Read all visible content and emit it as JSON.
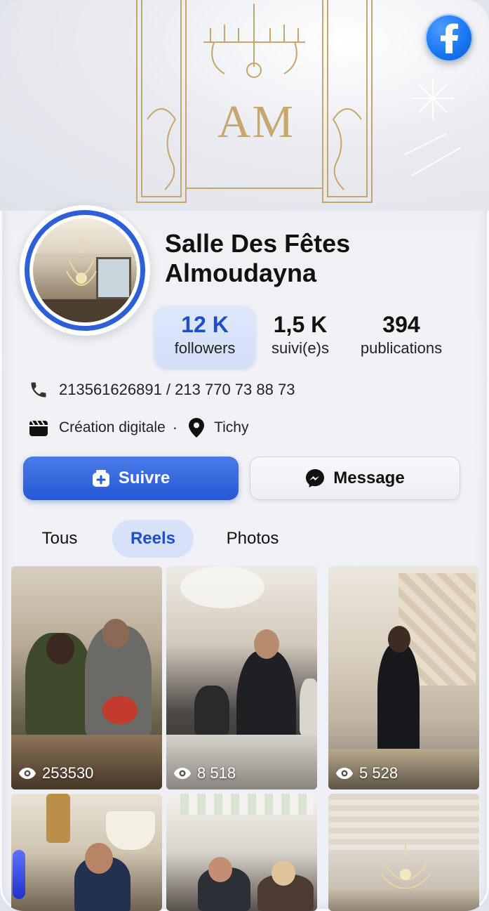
{
  "cover": {
    "monogram": "AM"
  },
  "profile": {
    "name_line1": "Salle Des Fêtes",
    "name_line2": "Almoudayna"
  },
  "stats": {
    "followers": {
      "value": "12 K",
      "label": "followers"
    },
    "following": {
      "value": "1,5 K",
      "label": "suivi(e)s"
    },
    "posts": {
      "value": "394",
      "label": "publications"
    }
  },
  "info": {
    "phone": "213561626891 / 213 770 73 88 73",
    "category": "Création digitale",
    "separator": "·",
    "location": "Tichy"
  },
  "actions": {
    "follow_label": "Suivre",
    "message_label": "Message"
  },
  "tabs": {
    "all": "Tous",
    "reels": "Reels",
    "photos": "Photos",
    "selected": "Reels"
  },
  "reels": [
    {
      "views": "253530"
    },
    {
      "views": "8 518"
    },
    {
      "views": "5 528"
    }
  ],
  "icons": {
    "badge": "facebook-icon",
    "phone": "phone-icon",
    "category": "clapperboard-icon",
    "location": "location-pin-icon",
    "follow": "follow-icon",
    "message": "messenger-icon",
    "views": "eye-icon"
  },
  "colors": {
    "accent": "#2558d4",
    "accent_text": "#1d4fc9",
    "facebook": "#1877f2",
    "tab_active_bg": "#d7e1f7"
  }
}
